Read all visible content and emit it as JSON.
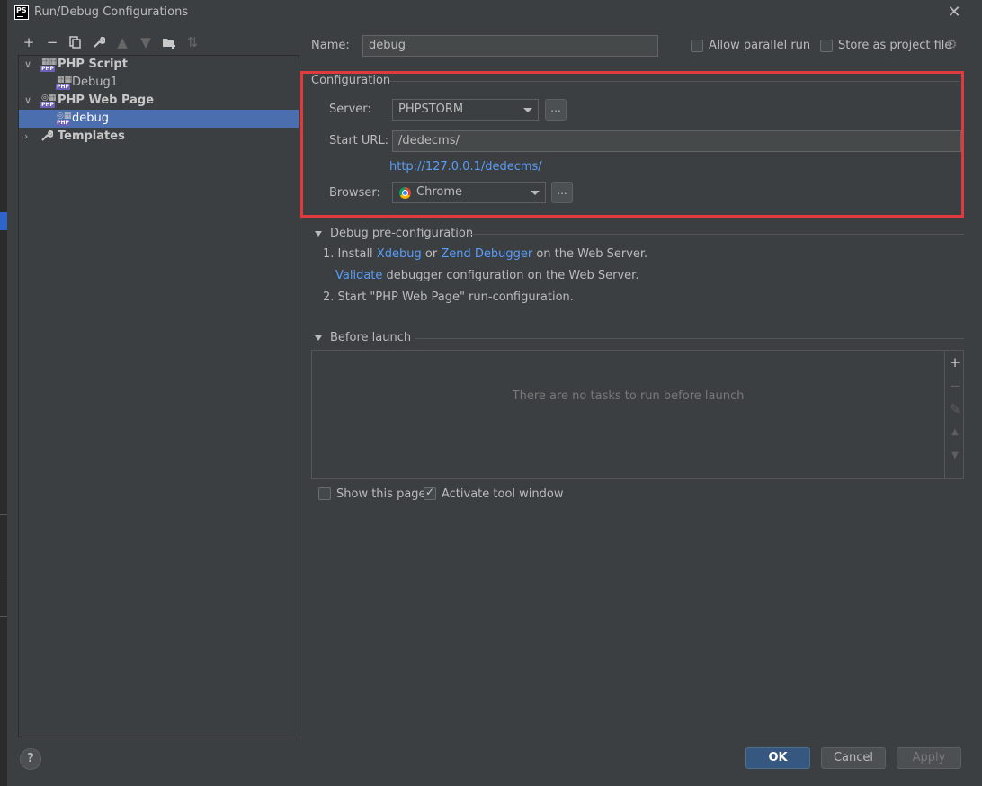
{
  "window": {
    "title": "Run/Debug Configurations",
    "app_icon_text": "PS"
  },
  "toolbar": {
    "buttons": [
      {
        "name": "add",
        "icon": "plus-icon",
        "glyph": "+"
      },
      {
        "name": "remove",
        "icon": "minus-icon",
        "glyph": "−"
      },
      {
        "name": "copy",
        "icon": "copy-icon"
      },
      {
        "name": "edit-defaults",
        "icon": "wrench-icon"
      },
      {
        "name": "move-up",
        "icon": "arrow-up-icon"
      },
      {
        "name": "move-down",
        "icon": "arrow-down-icon"
      },
      {
        "name": "new-folder",
        "icon": "folder-plus-icon"
      },
      {
        "name": "sort",
        "icon": "sort-icon"
      }
    ]
  },
  "tree": {
    "items": [
      {
        "label": "PHP Script",
        "level": 0,
        "expanded": true,
        "bold": true,
        "icon": "php-script-icon"
      },
      {
        "label": "Debug1",
        "level": 1,
        "icon": "php-script-icon"
      },
      {
        "label": "PHP Web Page",
        "level": 0,
        "expanded": true,
        "bold": true,
        "icon": "php-web-page-icon"
      },
      {
        "label": "debug",
        "level": 1,
        "selected": true,
        "icon": "php-web-page-icon"
      },
      {
        "label": "Templates",
        "level": 0,
        "expanded": false,
        "bold": true,
        "icon": "wrench-icon"
      }
    ],
    "php_tag": "PHP"
  },
  "form": {
    "name_label": "Name:",
    "name_value": "debug",
    "allow_parallel_label": "Allow parallel run",
    "allow_parallel_checked": false,
    "store_project_label": "Store as project file",
    "store_project_checked": false
  },
  "configuration": {
    "title": "Configuration",
    "server_label": "Server:",
    "server_value": "PHPSTORM",
    "start_url_label": "Start URL:",
    "start_url_value": "/dedecms/",
    "full_url": "http://127.0.0.1/dedecms/",
    "browser_label": "Browser:",
    "browser_value": "Chrome",
    "dots": "..."
  },
  "debug_preconfig": {
    "title": "Debug pre-configuration",
    "step1_prefix": "1. Install",
    "xdebug_link": "Xdebug",
    "or_text": "or",
    "zend_link": "Zend Debugger",
    "step1_suffix": "on the Web Server.",
    "validate_link": "Validate",
    "validate_suffix": "debugger configuration on the Web Server.",
    "step2": "2. Start \"PHP Web Page\" run-configuration."
  },
  "before_launch": {
    "title": "Before launch",
    "empty_text": "There are no tasks to run before launch"
  },
  "options": {
    "show_page_label": "Show this page",
    "show_page_checked": false,
    "activate_tool_label": "Activate tool window",
    "activate_tool_checked": true
  },
  "footer": {
    "help": "?",
    "ok": "OK",
    "cancel": "Cancel",
    "apply": "Apply"
  },
  "colors": {
    "accent": "#4b6eaf",
    "highlight_border": "#e0393e",
    "link": "#589df6",
    "primary_button": "#365880"
  }
}
